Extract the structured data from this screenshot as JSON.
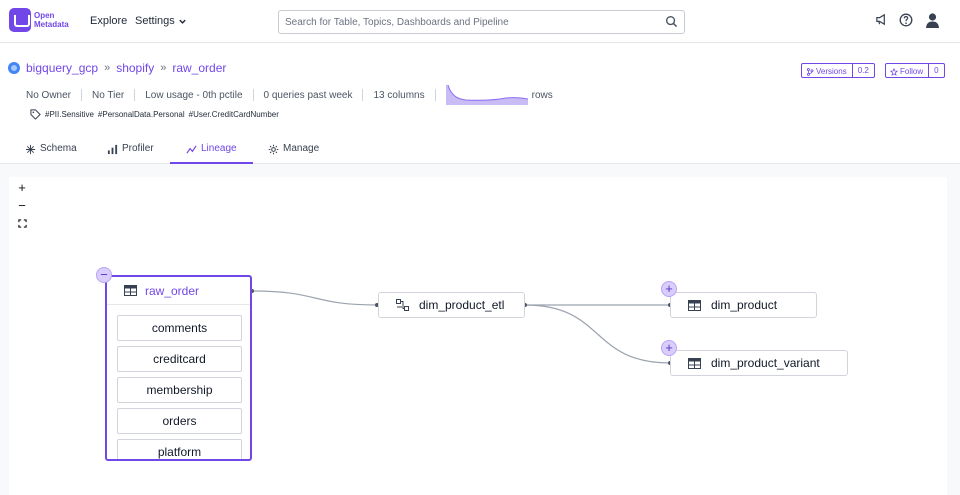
{
  "app": {
    "logo_line1": "Open",
    "logo_line2": "Metadata"
  },
  "nav": {
    "explore": "Explore",
    "settings": "Settings"
  },
  "search": {
    "placeholder": "Search for Table, Topics, Dashboards and Pipeline"
  },
  "icons": {
    "announcement": "megaphone-icon",
    "help": "help-icon",
    "user": "user-icon"
  },
  "breadcrumb": [
    "bigquery_gcp",
    "shopify",
    "raw_order"
  ],
  "meta": {
    "owner": "No Owner",
    "tier": "No Tier",
    "usage": "Low usage - 0th pctile",
    "queries": "0 queries past week",
    "columns": "13 columns",
    "rows_label": "rows"
  },
  "tags": [
    "#PII.Sensitive",
    "#PersonalData.Personal",
    "#User.CreditCardNumber"
  ],
  "versions": {
    "label": "Versions",
    "value": "0.2"
  },
  "follow": {
    "label": "Follow",
    "value": "0"
  },
  "tabs": [
    "Schema",
    "Profiler",
    "Lineage",
    "Manage"
  ],
  "active_tab": "Lineage",
  "zoom": {
    "in": "+",
    "out": "−"
  },
  "lineage": {
    "root": {
      "name": "raw_order",
      "columns": [
        "comments",
        "creditcard",
        "membership",
        "orders",
        "platform"
      ]
    },
    "pipeline": "dim_product_etl",
    "downstream": [
      "dim_product",
      "dim_product_variant"
    ]
  },
  "colors": {
    "accent": "#7147e8",
    "expand_bg": "#d9cdfb"
  }
}
